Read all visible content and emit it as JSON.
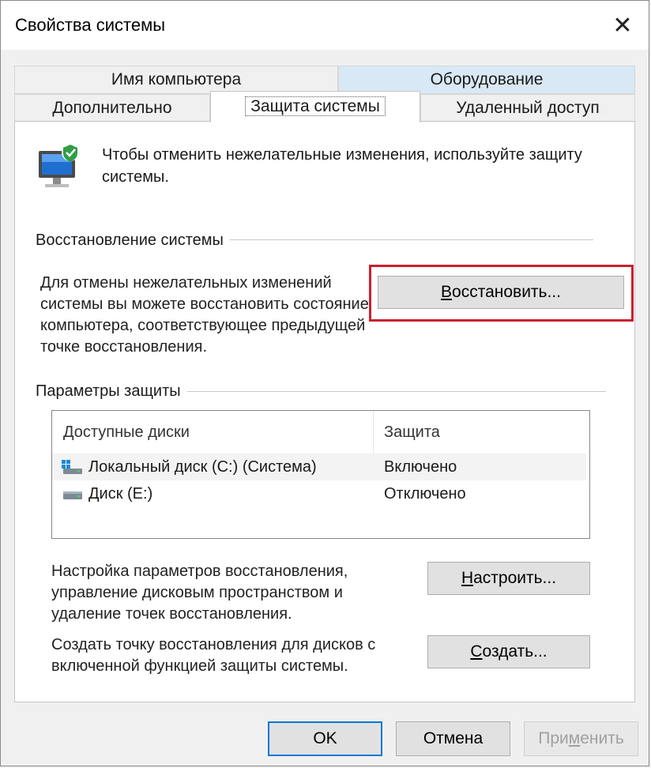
{
  "window": {
    "title": "Свойства системы",
    "close_symbol": "✕"
  },
  "tabs": {
    "computer_name": "Имя компьютера",
    "hardware": "Оборудование",
    "advanced": "Дополнительно",
    "system_protection": "Защита системы",
    "remote": "Удаленный доступ"
  },
  "intro": {
    "text": "Чтобы отменить нежелательные изменения, используйте защиту системы."
  },
  "restore": {
    "group_title": "Восстановление системы",
    "description": "Для отмены нежелательных изменений системы вы можете восстановить состояние компьютера, соответствующее предыдущей точке восстановления.",
    "button_label_underlined": "В",
    "button_label_rest": "осстановить..."
  },
  "protection": {
    "group_title": "Параметры защиты",
    "columns": {
      "drives": "Доступные диски",
      "protection": "Защита"
    },
    "rows": [
      {
        "name": "Локальный диск (C:) (Система)",
        "status": "Включено"
      },
      {
        "name": "Диск (E:)",
        "status": "Отключено"
      }
    ]
  },
  "configure": {
    "description": "Настройка параметров восстановления, управление дисковым пространством и удаление точек восстановления.",
    "button_label_underlined": "Н",
    "button_label_rest": "астроить..."
  },
  "create": {
    "description": "Создать точку восстановления для дисков с включенной функцией защиты системы.",
    "button_label_underlined": "С",
    "button_label_rest": "оздать..."
  },
  "footer": {
    "ok": "OK",
    "cancel": "Отмена",
    "apply_before": "При",
    "apply_underlined": "м",
    "apply_after": "енить"
  },
  "colors": {
    "highlight_border": "#cc1f2e",
    "hardware_tab_bg": "#d9e8f5",
    "ok_border": "#0078d7",
    "shield_icon": "#1a8ad8"
  }
}
